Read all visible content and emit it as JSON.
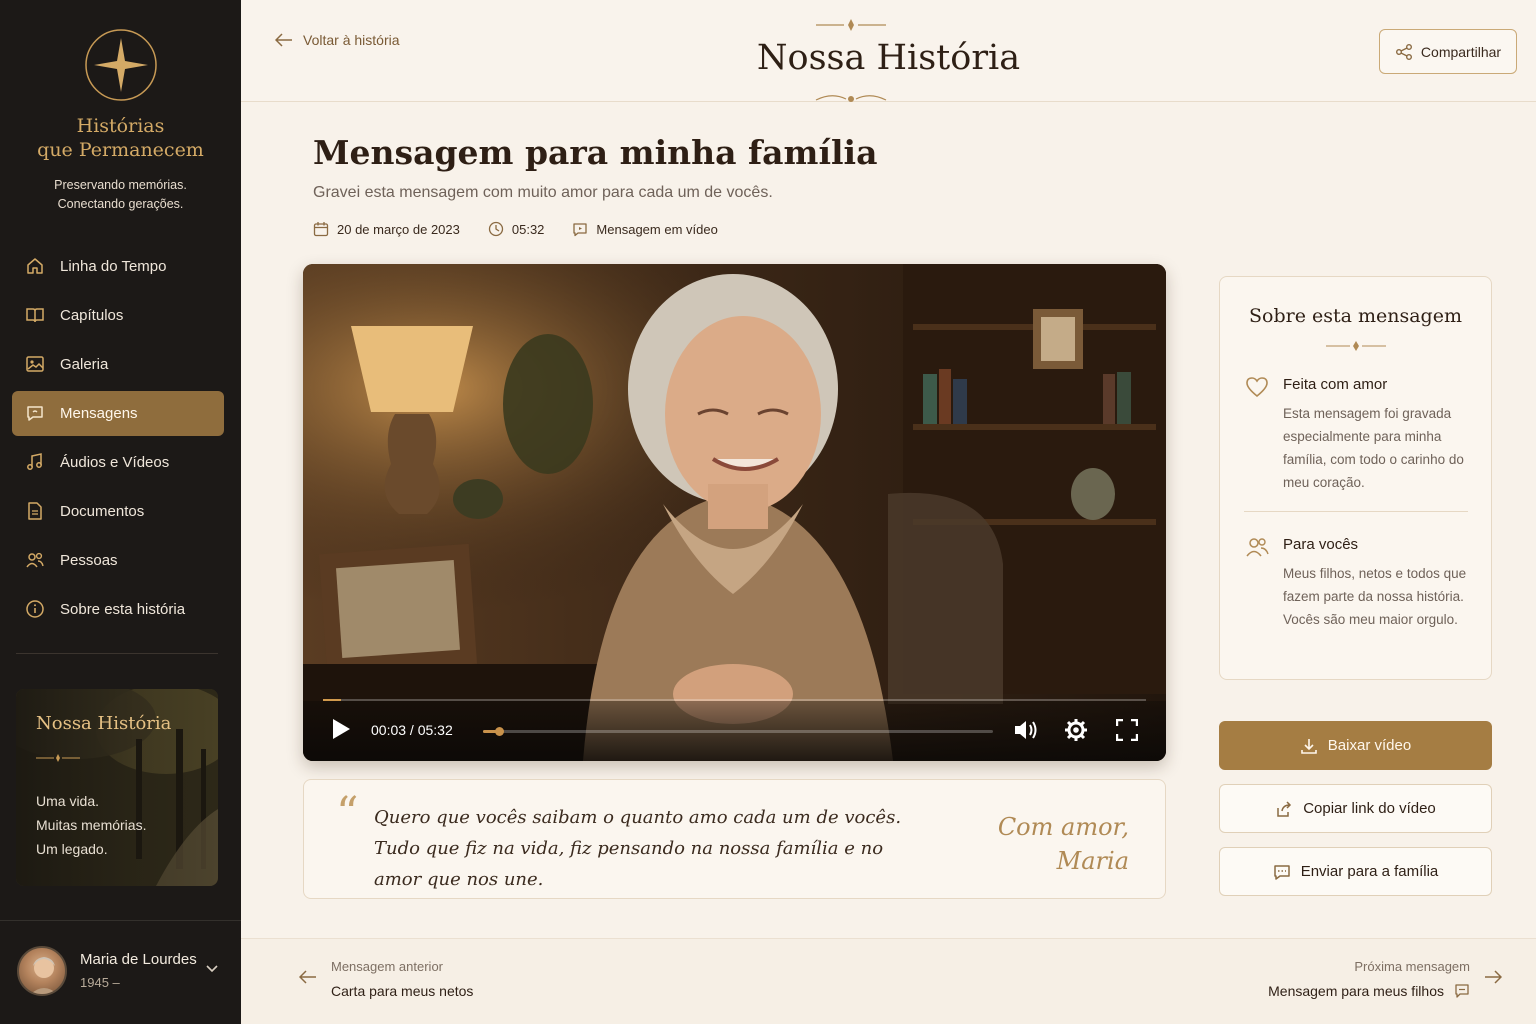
{
  "brand": {
    "title_line1": "Histórias",
    "title_line2": "que Permanecem",
    "tagline_line1": "Preservando memórias.",
    "tagline_line2": "Conectando gerações."
  },
  "nav": {
    "items": [
      {
        "label": "Linha do Tempo",
        "icon": "home-icon"
      },
      {
        "label": "Capítulos",
        "icon": "book-icon"
      },
      {
        "label": "Galeria",
        "icon": "image-icon"
      },
      {
        "label": "Mensagens",
        "icon": "message-icon",
        "active": true
      },
      {
        "label": "Áudios e Vídeos",
        "icon": "music-icon"
      },
      {
        "label": "Documentos",
        "icon": "document-icon"
      },
      {
        "label": "Pessoas",
        "icon": "people-icon"
      },
      {
        "label": "Sobre esta história",
        "icon": "info-icon"
      }
    ]
  },
  "story_card": {
    "title": "Nossa História",
    "line1": "Uma vida.",
    "line2": "Muitas memórias.",
    "line3": "Um legado."
  },
  "user": {
    "name": "Maria de Lourdes",
    "years": "1945 –"
  },
  "header": {
    "back_label": "Voltar à história",
    "title": "Nossa História",
    "share_label": "Compartilhar"
  },
  "message": {
    "title": "Mensagem para minha família",
    "subtitle": "Gravei esta mensagem com muito amor para cada um de vocês.",
    "date": "20 de março de 2023",
    "duration": "05:32",
    "type": "Mensagem em vídeo"
  },
  "video": {
    "time_display": "00:03 / 05:32",
    "progress_fraction": 0.009
  },
  "quote": {
    "text": "Quero que vocês saibam o quanto amo cada um de vocês. Tudo que fiz na vida, fiz pensando na nossa família e no amor que nos une.",
    "sign_line1": "Com amor,",
    "sign_line2": "Maria"
  },
  "about": {
    "title": "Sobre esta mensagem",
    "item1_title": "Feita com amor",
    "item1_text": "Esta mensagem foi gravada especialmente para minha família, com todo o carinho do meu coração.",
    "item2_title": "Para vocês",
    "item2_text": "Meus filhos, netos e todos que fazem parte da nossa história. Vocês são meu maior orgulo."
  },
  "actions": {
    "download": "Baixar vídeo",
    "copy_link": "Copiar link do vídeo",
    "send": "Enviar para a família"
  },
  "footer": {
    "prev_label": "Mensagem anterior",
    "prev_title": "Carta para meus netos",
    "next_label": "Próxima mensagem",
    "next_title": "Mensagem para meus filhos"
  },
  "colors": {
    "accent": "#a57d43",
    "sidebar_bg": "#1c1917",
    "page_bg": "#f8f2ea"
  }
}
